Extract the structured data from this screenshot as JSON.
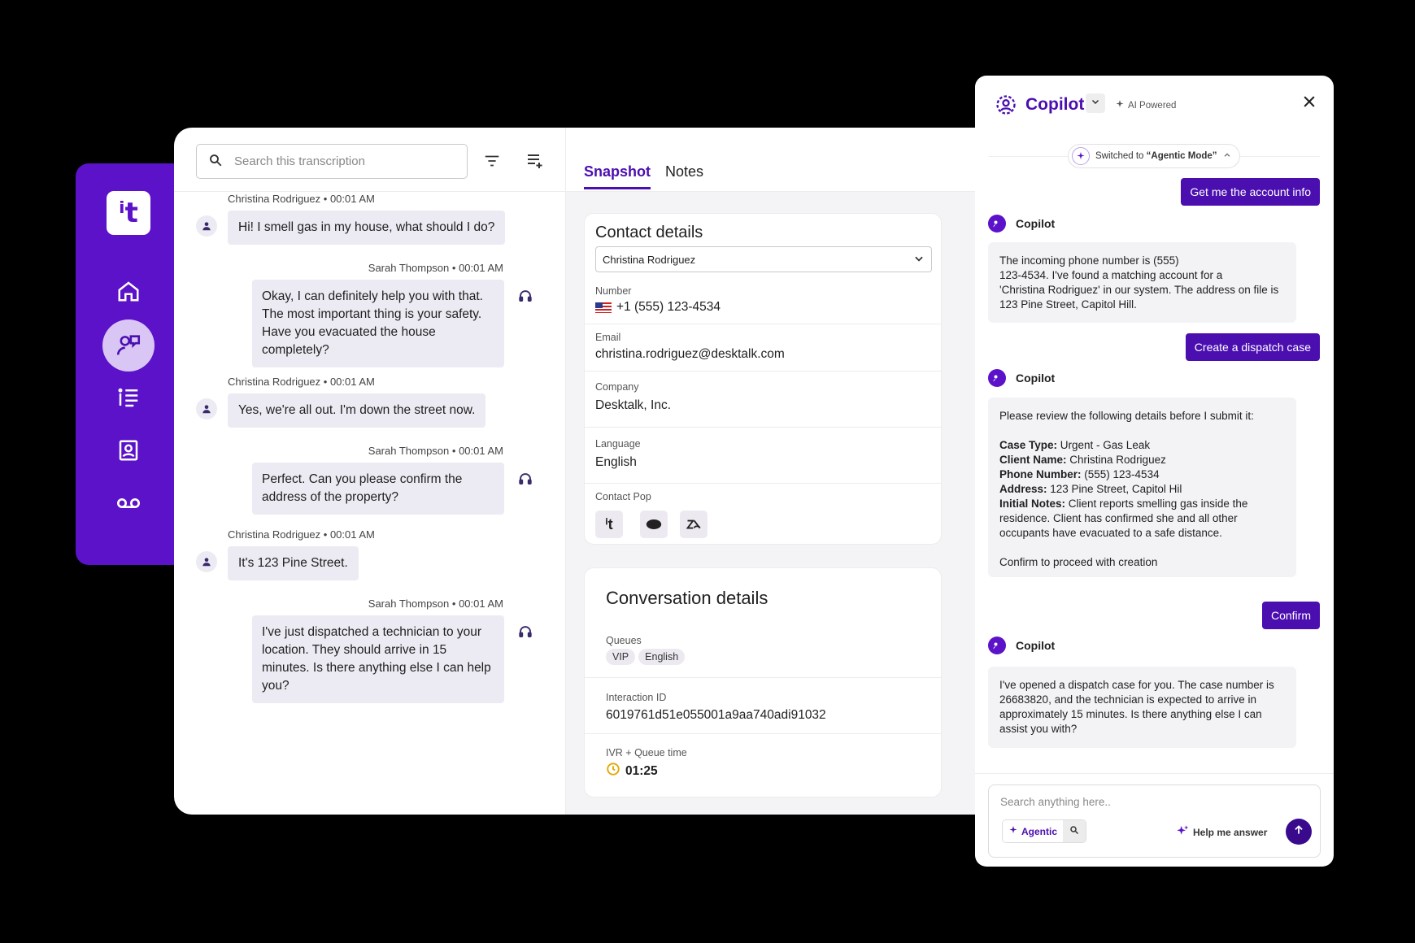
{
  "sidebar": {
    "logo_text": "ⁱt",
    "nav": [
      "home-icon",
      "agent-assist-icon",
      "list-icon",
      "contacts-icon",
      "voicemail-icon"
    ]
  },
  "transcript": {
    "search_placeholder": "Search this transcription",
    "messages": [
      {
        "author": "Christina Rodriguez",
        "time": "00:01 AM",
        "side": "customer",
        "lines": [
          "Hi! I smell gas in my house, what should I do?"
        ]
      },
      {
        "author": "Sarah Thompson",
        "time": "00:01 AM",
        "side": "agent",
        "lines": [
          "Okay, I can definitely help you with that.",
          "The most important thing is your safety.",
          "Have you evacuated the house",
          "completely?"
        ]
      },
      {
        "author": "Christina Rodriguez",
        "time": "00:01 AM",
        "side": "customer",
        "lines": [
          "Yes, we're all out. I'm down the street now."
        ]
      },
      {
        "author": "Sarah Thompson",
        "time": "00:01 AM",
        "side": "agent",
        "lines": [
          "Perfect. Can you please confirm the",
          "address of the property?"
        ]
      },
      {
        "author": "Christina Rodriguez",
        "time": "00:01 AM",
        "side": "customer",
        "lines": [
          "It's 123 Pine Street."
        ]
      },
      {
        "author": "Sarah Thompson",
        "time": "00:01 AM",
        "side": "agent",
        "lines": [
          "I've just dispatched a technician to your",
          "location. They should arrive in 15",
          "minutes. Is there anything else I can help",
          "you?"
        ]
      }
    ]
  },
  "details": {
    "tabs": [
      "Snapshot",
      "Notes"
    ],
    "contact": {
      "title": "Contact details",
      "selected": "Christina Rodriguez",
      "number_label": "Number",
      "number": "+1 (555) 123-4534",
      "email_label": "Email",
      "email": "christina.rodriguez@desktalk.com",
      "company_label": "Company",
      "company": "Desktalk, Inc.",
      "language_label": "Language",
      "language": "English",
      "pop_label": "Contact Pop"
    },
    "conversation": {
      "title": "Conversation details",
      "queues_label": "Queues",
      "queues": [
        "VIP",
        "English"
      ],
      "interaction_label": "Interaction ID",
      "interaction_id": "6019761d51e055001a9aa740adi91032",
      "ivr_label": "IVR + Queue time",
      "ivr_time": "01:25"
    }
  },
  "copilot": {
    "title": "Copilot",
    "tag": "AI Powered",
    "mode_notice_prefix": "Switched to ",
    "mode_notice_mode": "“Agentic Mode”",
    "user_msg_1": "Get me the account info",
    "bot_name": "Copilot",
    "bot_1_lines": [
      "The incoming phone number is (555)",
      "123-4534. I've found a matching account for a",
      "'Christina Rodriguez' in our system. The address on file is",
      "123 Pine Street, Capitol Hill."
    ],
    "user_msg_2": "Create a dispatch case",
    "bot_2_intro": "Please review the following details before I submit it:",
    "bot_2_fields": [
      {
        "k": "Case Type:",
        "v": " Urgent - Gas Leak"
      },
      {
        "k": "Client Name:",
        "v": " Christina Rodriguez"
      },
      {
        "k": "Phone Number:",
        "v": " (555) 123-4534"
      },
      {
        "k": "Address:",
        "v": " 123 Pine Street, Capitol Hil"
      }
    ],
    "bot_2_notes_key": "Initial Notes:",
    "bot_2_notes_lines": [
      " Client reports smelling gas inside the",
      "residence. Client has confirmed she and all other",
      "occupants have evacuated to a safe distance."
    ],
    "bot_2_outro": "Confirm to proceed with creation",
    "user_msg_3": "Confirm",
    "bot_3_lines": [
      "I've opened a dispatch case for you. The case number is",
      "26683820, and the technician is expected to arrive in",
      "approximately 15 minutes. Is there anything else I can",
      "assist you with?"
    ],
    "input_placeholder": "Search anything here..",
    "agentic_label": "Agentic",
    "help_label": "Help me answer"
  }
}
